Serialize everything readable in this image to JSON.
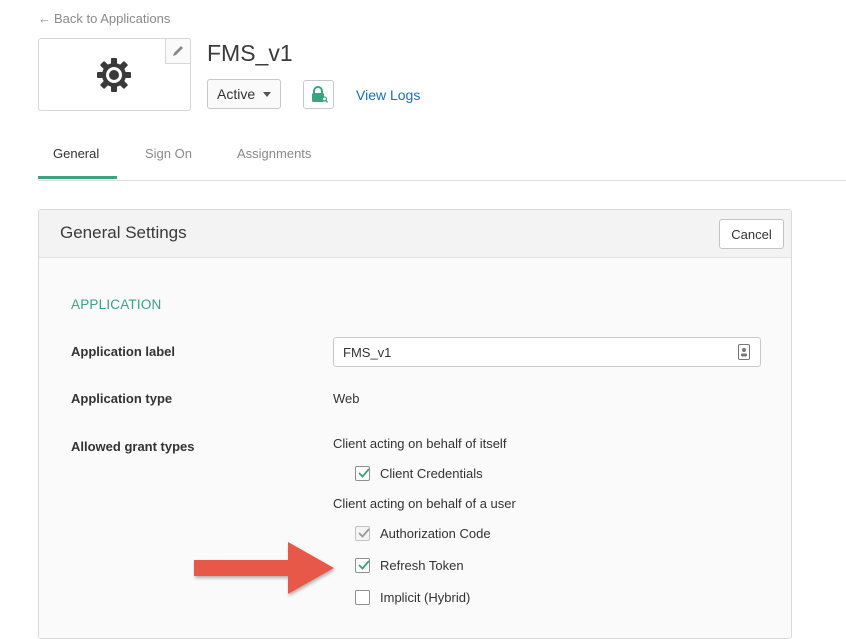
{
  "nav": {
    "back_label": "Back to Applications",
    "back_arrow": "←"
  },
  "app": {
    "name": "FMS_v1",
    "logo_icon": "gear-icon",
    "status": "Active",
    "view_logs": "View Logs"
  },
  "tabs": [
    {
      "label": "General",
      "active": true
    },
    {
      "label": "Sign On",
      "active": false
    },
    {
      "label": "Assignments",
      "active": false
    }
  ],
  "panel": {
    "title": "General Settings",
    "cancel_label": "Cancel",
    "section_heading": "APPLICATION",
    "fields": {
      "label": {
        "name": "Application label",
        "value": "FMS_v1"
      },
      "type": {
        "name": "Application type",
        "value": "Web"
      },
      "grants": {
        "name": "Allowed grant types"
      }
    },
    "grant_groups": [
      {
        "label": "Client acting on behalf of itself",
        "options": [
          {
            "label": "Client Credentials",
            "checked": true,
            "disabled": false
          }
        ]
      },
      {
        "label": "Client acting on behalf of a user",
        "options": [
          {
            "label": "Authorization Code",
            "checked": true,
            "disabled": true
          },
          {
            "label": "Refresh Token",
            "checked": true,
            "disabled": false
          },
          {
            "label": "Implicit (Hybrid)",
            "checked": false,
            "disabled": false
          }
        ]
      }
    ]
  },
  "colors": {
    "accent": "#3aa37f",
    "link": "#1a6fb5",
    "arrow": "#e8584a"
  }
}
